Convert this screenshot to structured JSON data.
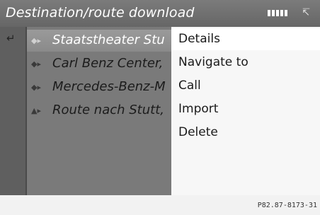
{
  "header": {
    "title": "Destination/route download",
    "signal_icon": "signal-strength-icon",
    "phone_icon": "phone-status-icon"
  },
  "nav": {
    "back_icon": "back-icon"
  },
  "list": {
    "items": [
      {
        "label": "Staatstheater Stu",
        "icon": "destination-icon"
      },
      {
        "label": "Carl Benz Center,",
        "icon": "destination-icon"
      },
      {
        "label": "Mercedes-Benz-M",
        "icon": "destination-icon"
      },
      {
        "label": "Route nach Stutt,",
        "icon": "route-icon"
      }
    ]
  },
  "menu": {
    "items": [
      {
        "label": "Details"
      },
      {
        "label": "Navigate to"
      },
      {
        "label": "Call"
      },
      {
        "label": "Import"
      },
      {
        "label": "Delete"
      }
    ]
  },
  "footer": {
    "reference": "P82.87-8173-31"
  }
}
